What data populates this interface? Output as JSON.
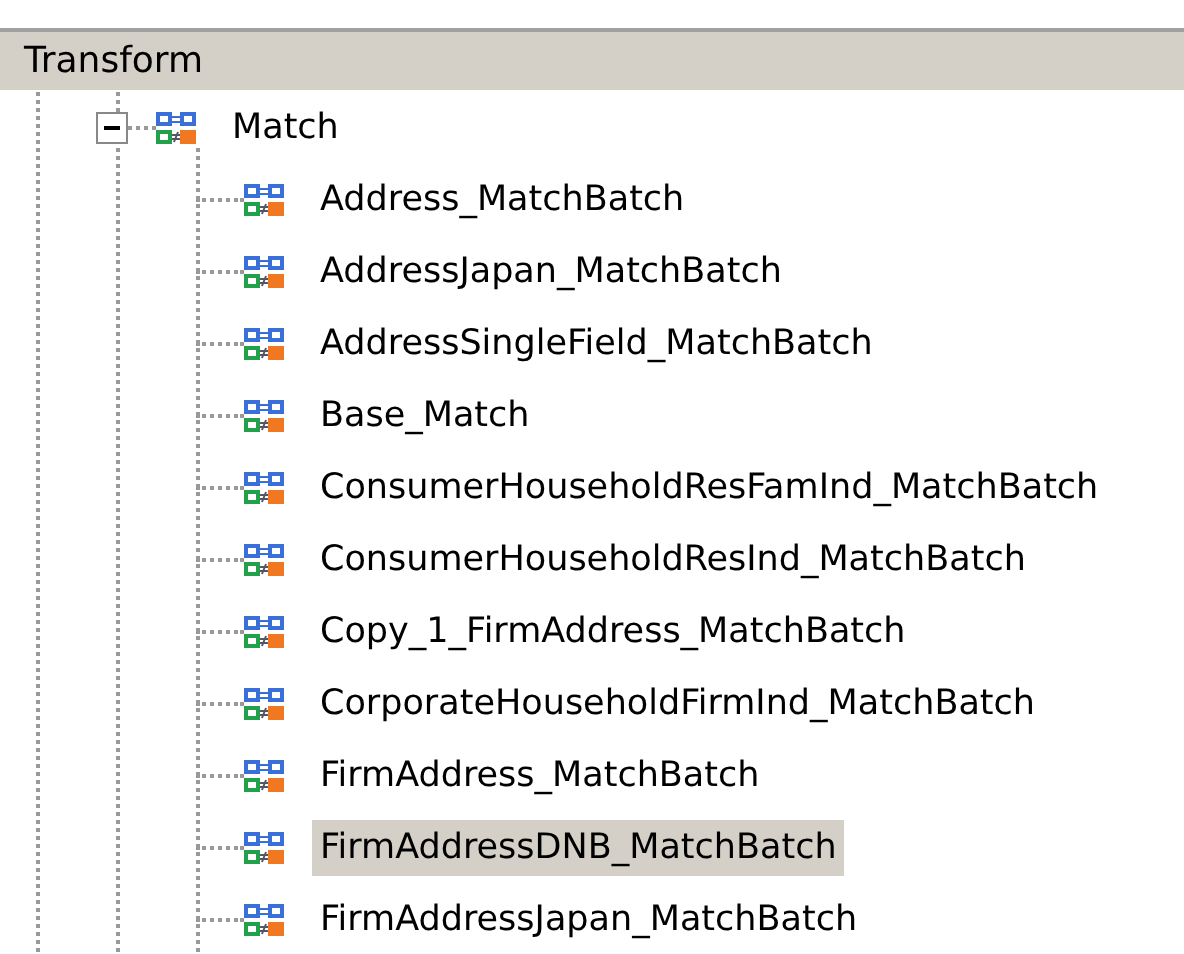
{
  "panel": {
    "title": "Transform"
  },
  "tree": [
    {
      "label": "Match",
      "expanded": true,
      "selected": false,
      "children": [
        {
          "label": "Address_MatchBatch",
          "selected": false
        },
        {
          "label": "AddressJapan_MatchBatch",
          "selected": false
        },
        {
          "label": "AddressSingleField_MatchBatch",
          "selected": false
        },
        {
          "label": "Base_Match",
          "selected": false
        },
        {
          "label": "ConsumerHouseholdResFamInd_MatchBatch",
          "selected": false
        },
        {
          "label": "ConsumerHouseholdResInd_MatchBatch",
          "selected": false
        },
        {
          "label": "Copy_1_FirmAddress_MatchBatch",
          "selected": false
        },
        {
          "label": "CorporateHouseholdFirmInd_MatchBatch",
          "selected": false
        },
        {
          "label": "FirmAddress_MatchBatch",
          "selected": false
        },
        {
          "label": "FirmAddressDNB_MatchBatch",
          "selected": true
        },
        {
          "label": "FirmAddressJapan_MatchBatch",
          "selected": false
        }
      ]
    }
  ]
}
